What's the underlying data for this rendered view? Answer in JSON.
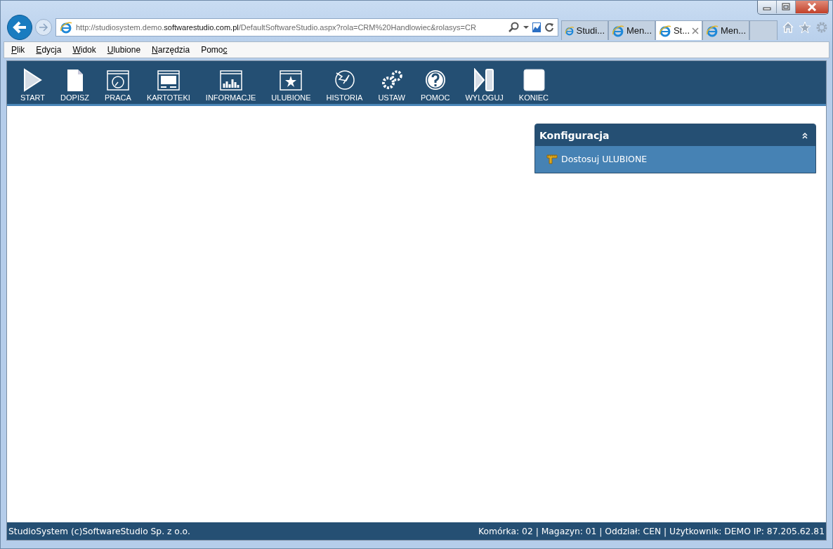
{
  "browser": {
    "address": {
      "before": "http://studiosystem.demo.",
      "domain": "softwarestudio.com.pl",
      "after": "/DefaultSoftwareStudio.aspx?rola=CRM%20Handlowiec&rolasys=CR"
    },
    "tabs": [
      {
        "title": "Studi...",
        "selected": false
      },
      {
        "title": "Men...",
        "selected": false
      },
      {
        "title": "St...",
        "selected": true
      },
      {
        "title": "Men...",
        "selected": false
      }
    ],
    "menu": [
      {
        "key": "P",
        "after": "lik"
      },
      {
        "key": "E",
        "after": "dycja"
      },
      {
        "key": "W",
        "after": "idok"
      },
      {
        "key": "U",
        "after": "lubione"
      },
      {
        "key": "N",
        "after": "arzędzia"
      },
      {
        "before": "Pomo",
        "key": "c"
      }
    ]
  },
  "toolbar": [
    {
      "label": "START"
    },
    {
      "label": "DOPISZ"
    },
    {
      "label": "PRACA"
    },
    {
      "label": "KARTOTEKI"
    },
    {
      "label": "INFORMACJE"
    },
    {
      "label": "ULUBIONE"
    },
    {
      "label": "HISTORIA"
    },
    {
      "label": "USTAW"
    },
    {
      "label": "POMOC"
    },
    {
      "label": "WYLOGUJ"
    },
    {
      "label": "KONIEC"
    }
  ],
  "panel": {
    "title": "Konfiguracja",
    "expanded": true,
    "items": [
      {
        "label": "Dostosuj ULUBIONE"
      }
    ]
  },
  "status_bar": {
    "left": "StudioSystem (c)SoftwareStudio Sp. z o.o.",
    "right": "Komórka: 02 | Magazyn: 01 | Oddział: CEN | Użytkownik: DEMO IP: 87.205.62.81"
  }
}
